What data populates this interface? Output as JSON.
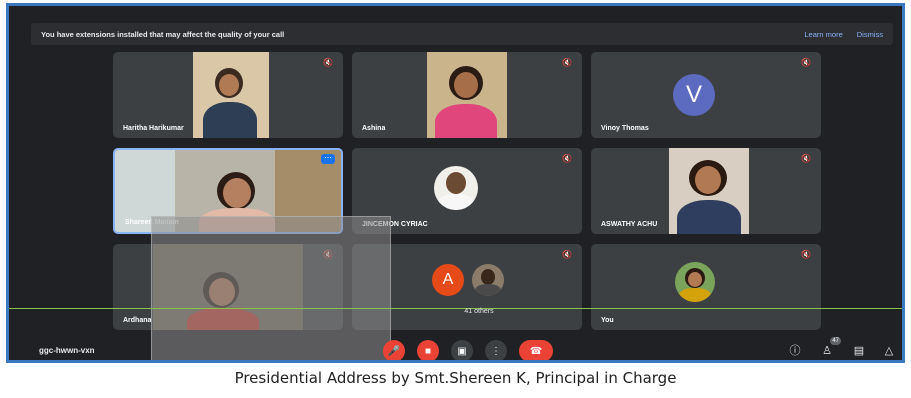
{
  "banner": {
    "message": "You have extensions installed that may affect the quality of your call",
    "learn_more": "Learn more",
    "dismiss": "Dismiss"
  },
  "participants": [
    {
      "name": "Haritha Harikumar"
    },
    {
      "name": "Ashina"
    },
    {
      "name": "Vinoy Thomas",
      "initial": "V",
      "color": "#5c6bc0"
    },
    {
      "name": "Shareen Manam"
    },
    {
      "name": "JINCEMON CYRIAC"
    },
    {
      "name": "ASWATHY ACHU"
    },
    {
      "name": "Ardhana"
    },
    {
      "name": "41 others",
      "initial": "A",
      "color": "#e64a19"
    },
    {
      "name": "You"
    }
  ],
  "meeting_code": "ggc-hwwn-vxn",
  "people_count": "47",
  "caption": "Presidential Address by Smt.Shereen K, Principal in Charge",
  "colors": {
    "frame_border": "#3a78c2",
    "background": "#202124",
    "tile": "#3c4043",
    "accent_red": "#ea4335"
  }
}
